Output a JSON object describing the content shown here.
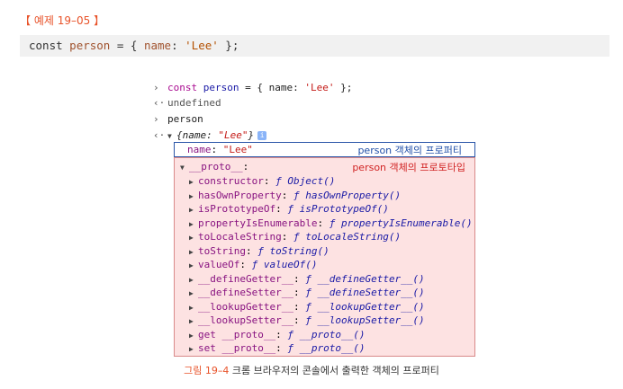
{
  "example_title": "【 예제 19–05 】",
  "code": {
    "keyword": "const",
    "var": "person",
    "mid": " = { ",
    "prop": "name",
    "colon": ": ",
    "str": "'Lee'",
    "end": " };"
  },
  "console": {
    "line1": {
      "kw": "const",
      "var": "person",
      "rest": " = { name: ",
      "str": "'Lee'",
      "end": " };"
    },
    "line2": "undefined",
    "line3": "person",
    "line4": {
      "pre": "{name: ",
      "str": "\"Lee\"",
      "post": "}",
      "info": "i"
    }
  },
  "own": {
    "key": "name",
    "value": "\"Lee\"",
    "label": "person 객체의 프로퍼티"
  },
  "proto": {
    "key": "__proto__",
    "label": "person 객체의 프로토타입",
    "items": [
      {
        "key": "constructor",
        "fn": "Object()"
      },
      {
        "key": "hasOwnProperty",
        "fn": "hasOwnProperty()"
      },
      {
        "key": "isPrototypeOf",
        "fn": "isPrototypeOf()"
      },
      {
        "key": "propertyIsEnumerable",
        "fn": "propertyIsEnumerable()"
      },
      {
        "key": "toLocaleString",
        "fn": "toLocaleString()"
      },
      {
        "key": "toString",
        "fn": "toString()"
      },
      {
        "key": "valueOf",
        "fn": "valueOf()"
      },
      {
        "key": "__defineGetter__",
        "fn": "__defineGetter__()"
      },
      {
        "key": "__defineSetter__",
        "fn": "__defineSetter__()"
      },
      {
        "key": "__lookupGetter__",
        "fn": "__lookupGetter__()"
      },
      {
        "key": "__lookupSetter__",
        "fn": "__lookupSetter__()"
      },
      {
        "key": "get __proto__",
        "fn": "__proto__()"
      },
      {
        "key": "set __proto__",
        "fn": "__proto__()"
      }
    ]
  },
  "caption": {
    "figure": "그림 19–4",
    "text": " 크롬 브라우저의 콘솔에서 출력한 객체의 프로퍼티"
  }
}
